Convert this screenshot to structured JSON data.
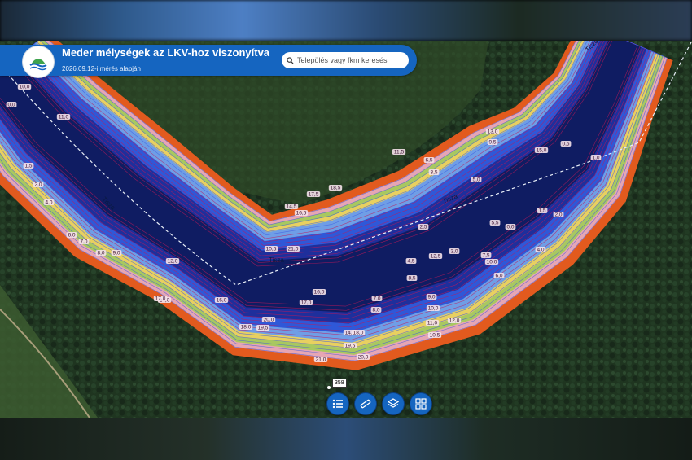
{
  "header": {
    "title": "Meder mélységek az LKV-hoz viszonyítva",
    "subtitle": "2026.09.12-i mérés alapján"
  },
  "search": {
    "placeholder": "Település vagy fkm keresés"
  },
  "map": {
    "river_name": "Tisza",
    "river_km_marker": "358",
    "colors": {
      "forest": "#1f3520",
      "bank": "#e25a1e",
      "shallow_yellow": "#e8d060",
      "shallow_green": "#a8c860",
      "light_pink": "#e6a6b4",
      "light_blue": "#6f9ee6",
      "mid_blue": "#2f58d8",
      "deep_blue": "#1e2f9c",
      "deepest": "#0f1c62",
      "contour": "#c0185a"
    },
    "depth_labels": [
      {
        "text": "0,0"
      },
      {
        "text": "1,5"
      },
      {
        "text": "2,0"
      },
      {
        "text": "4,0"
      },
      {
        "text": "6,0"
      },
      {
        "text": "7,0"
      },
      {
        "text": "8,0"
      },
      {
        "text": "9,0"
      },
      {
        "text": "10,0"
      },
      {
        "text": "11,0"
      },
      {
        "text": "12,0"
      },
      {
        "text": "14,0"
      },
      {
        "text": "16,0"
      },
      {
        "text": "17,0"
      },
      {
        "text": "18,0"
      },
      {
        "text": "19,5"
      },
      {
        "text": "20,0"
      },
      {
        "text": "21,0"
      },
      {
        "text": "10,5"
      },
      {
        "text": "14,5"
      },
      {
        "text": "16,5"
      },
      {
        "text": "17,5"
      },
      {
        "text": "18,5"
      },
      {
        "text": "11,5"
      },
      {
        "text": "6,5"
      },
      {
        "text": "3,5"
      },
      {
        "text": "5,0"
      },
      {
        "text": "9,5"
      },
      {
        "text": "13,0"
      },
      {
        "text": "15,0"
      },
      {
        "text": "0,5"
      },
      {
        "text": "1,0"
      },
      {
        "text": "2,5"
      },
      {
        "text": "4,5"
      },
      {
        "text": "8,5"
      },
      {
        "text": "12,5"
      },
      {
        "text": "3,0"
      },
      {
        "text": "7,5"
      },
      {
        "text": "10,0"
      },
      {
        "text": "5,5"
      }
    ]
  },
  "toolbar": {
    "buttons": [
      {
        "name": "legend-list-icon"
      },
      {
        "name": "measure-ruler-icon"
      },
      {
        "name": "layers-icon"
      },
      {
        "name": "basemap-gallery-icon"
      }
    ]
  }
}
